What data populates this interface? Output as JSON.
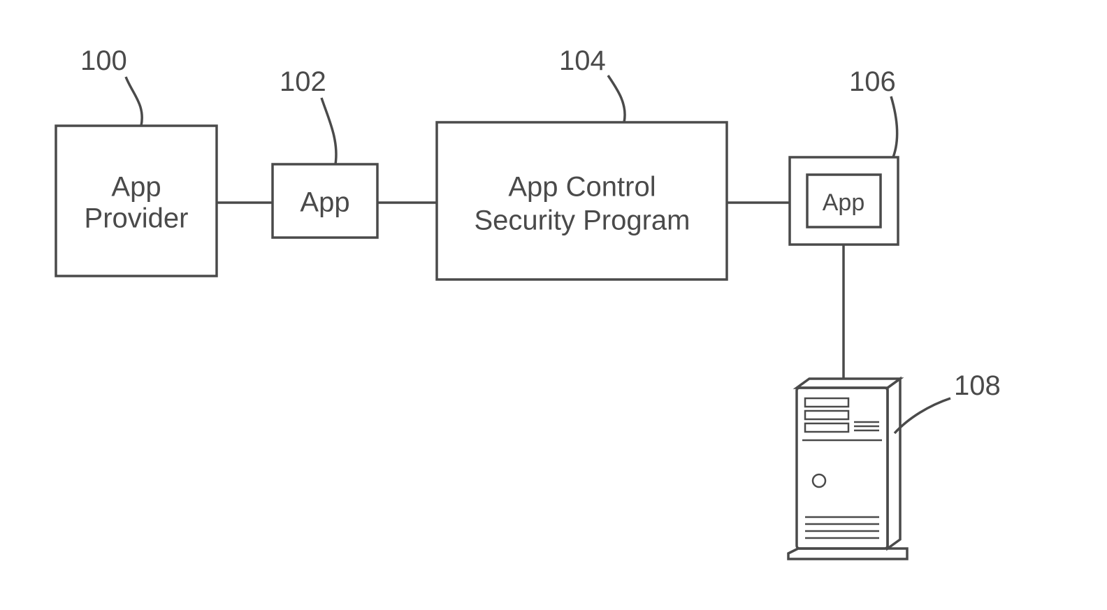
{
  "labels": {
    "n100": "100",
    "n102": "102",
    "n104": "104",
    "n106": "106",
    "n108": "108"
  },
  "boxes": {
    "provider_line1": "App",
    "provider_line2": "Provider",
    "app1": "App",
    "control_line1": "App Control",
    "control_line2": "Security Program",
    "app2": "App"
  }
}
